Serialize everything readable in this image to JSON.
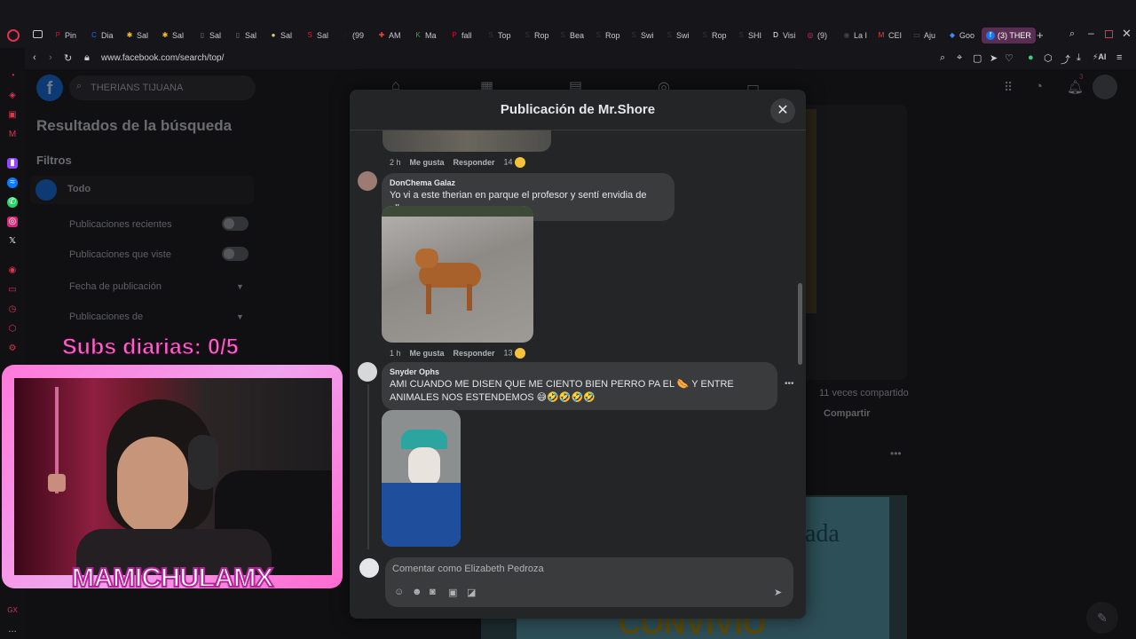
{
  "tabs": [
    {
      "icon": "P",
      "label": "Pin",
      "color": "#e60023"
    },
    {
      "icon": "C",
      "label": "Dia",
      "color": "#1a73e8"
    },
    {
      "icon": "✱",
      "label": "Sal",
      "color": "#ffc220"
    },
    {
      "icon": "✱",
      "label": "Sal",
      "color": "#ffc220"
    },
    {
      "icon": "▯",
      "label": "Sal",
      "color": "#777777"
    },
    {
      "icon": "▯",
      "label": "Sal",
      "color": "#777777"
    },
    {
      "icon": "●",
      "label": "Sal",
      "color": "#d8d07a"
    },
    {
      "icon": "S",
      "label": "Sal",
      "color": "#e31837"
    },
    {
      "icon": "♪",
      "label": "(99",
      "color": "#222222"
    },
    {
      "icon": "✚",
      "label": "AM",
      "color": "#ea4335"
    },
    {
      "icon": "K",
      "label": "Ma",
      "color": "#2aa84a"
    },
    {
      "icon": "P",
      "label": "fall",
      "color": "#e60023"
    },
    {
      "icon": "S",
      "label": "Top",
      "color": "#333333"
    },
    {
      "icon": "S",
      "label": "Rop",
      "color": "#333333"
    },
    {
      "icon": "S",
      "label": "Bea",
      "color": "#333333"
    },
    {
      "icon": "S",
      "label": "Rop",
      "color": "#333333"
    },
    {
      "icon": "S",
      "label": "Swi",
      "color": "#333333"
    },
    {
      "icon": "S",
      "label": "Swi",
      "color": "#333333"
    },
    {
      "icon": "S",
      "label": "Rop",
      "color": "#333333"
    },
    {
      "icon": "S",
      "label": "SHI",
      "color": "#333333"
    },
    {
      "icon": "D",
      "label": "Visi",
      "color": "#ffffff"
    },
    {
      "icon": "◎",
      "label": "(9)",
      "color": "#d62976"
    },
    {
      "icon": "◉",
      "label": "La I",
      "color": "#444444"
    },
    {
      "icon": "M",
      "label": "CEI",
      "color": "#ea4335"
    },
    {
      "icon": "▭",
      "label": "Aju",
      "color": "#555555"
    },
    {
      "icon": "◆",
      "label": "Goo",
      "color": "#4285f4"
    }
  ],
  "active_tab": {
    "icon": "f",
    "label": "(3) THER",
    "color": "#1877f2"
  },
  "url": "www.facebook.com/search/top/",
  "fb": {
    "search_value": "THERIANS TIJUANA",
    "sidebar_title": "Resultados de la búsqueda",
    "filters_label": "Filtros",
    "all_label": "Todo",
    "options": [
      "Publicaciones recientes",
      "Publicaciones que viste",
      "Fecha de publicación",
      "Publicaciones de"
    ],
    "notif_count": "3",
    "shared_count": "11 veces compartido",
    "share_label": "Compartir",
    "bg_word": "ada",
    "bg_word2": "CONVIVIO"
  },
  "modal": {
    "title": "Publicación de Mr.Shore",
    "top_meta": {
      "time": "2 h",
      "like": "Me gusta",
      "reply": "Responder",
      "count": "14"
    },
    "comments": [
      {
        "author": "DonChema Galaz",
        "text": "Yo vi a este therian en parque el profesor y sentí envidia de ellos",
        "time": "1 h",
        "like": "Me gusta",
        "reply": "Responder",
        "count": "13"
      },
      {
        "author": "Snyder Ophs",
        "text": "AMI CUANDO ME DISEN QUE ME CIENTO BIEN PERRO PA EL 🌭 Y ENTRE ANIMALES NOS ESTENDEMOS 😅🤣🤣🤣🤣"
      }
    ],
    "compose_placeholder": "Comentar como Elizabeth Pedroza"
  },
  "overlay": {
    "subs": "Subs diarias: 0/5",
    "streamer": "MAMICHULAMX"
  },
  "colors": {
    "accent": "#1877f2",
    "overlay_pink": "#ff5fc8"
  }
}
